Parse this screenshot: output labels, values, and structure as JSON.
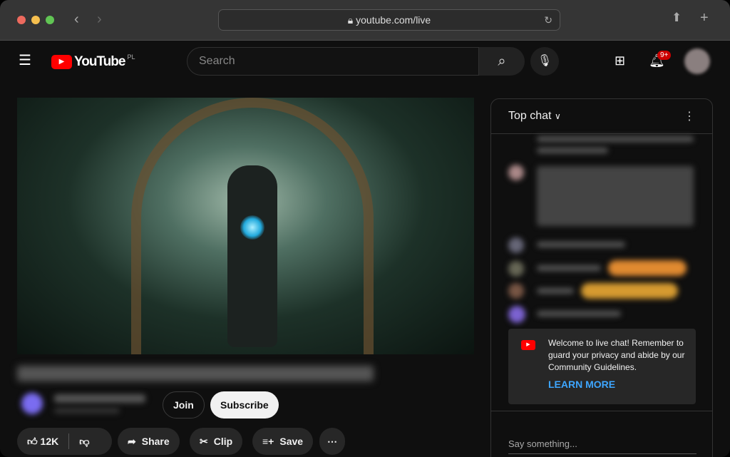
{
  "browser": {
    "url": "youtube.com/live"
  },
  "header": {
    "logo_text": "YouTube",
    "region": "PL",
    "search_placeholder": "Search",
    "notifications_badge": "9+"
  },
  "video": {
    "likes": "12K",
    "actions": {
      "join": "Join",
      "subscribe": "Subscribe",
      "share": "Share",
      "clip": "Clip",
      "save": "Save"
    }
  },
  "chat": {
    "mode": "Top chat",
    "welcome": "Welcome to live chat! Remember to guard your privacy and abide by our Community Guidelines.",
    "learn_more": "LEARN MORE",
    "input_placeholder": "Say something..."
  },
  "colors": {
    "accent": "#3ea6ff",
    "brand": "#ff0000",
    "badge": "#cc0000"
  }
}
